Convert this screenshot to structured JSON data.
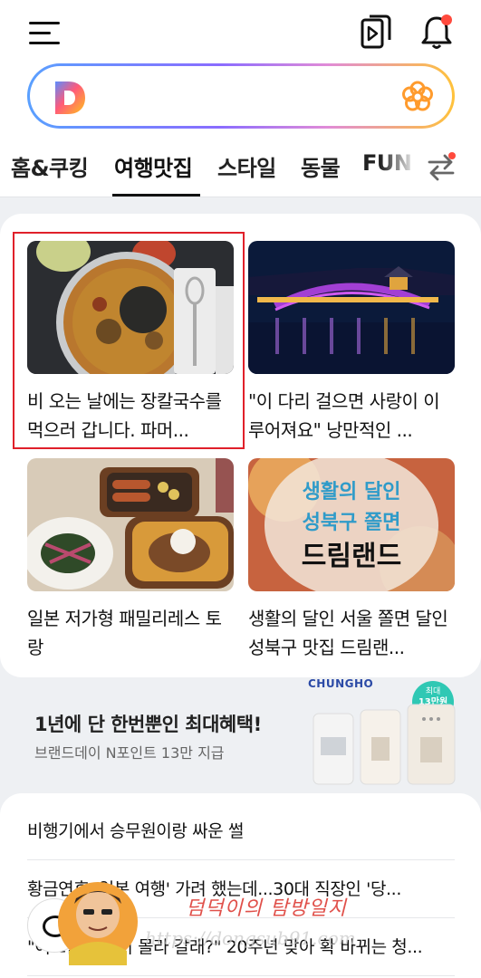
{
  "header": {
    "icons": [
      "hamburger-menu-icon",
      "video-icon",
      "bell-icon"
    ],
    "notification_dot_color": "#ff4a3d"
  },
  "search": {
    "placeholder": "",
    "value": "",
    "logo_letter": "D",
    "flower_color": "#ff9b2d"
  },
  "tabs": [
    {
      "label": "홈&쿠킹",
      "active": false
    },
    {
      "label": "여행맛집",
      "active": true
    },
    {
      "label": "스타일",
      "active": false
    },
    {
      "label": "동물",
      "active": false
    },
    {
      "label": "FUN",
      "active": false
    }
  ],
  "cards": [
    {
      "title": "비 오는 날에는 장칼국수를 먹으러 갑니다. 파머...",
      "highlighted": true
    },
    {
      "title": "\"이 다리 걸으면 사랑이 이루어져요\" 낭만적인 ..."
    },
    {
      "title": "일본 저가형 패밀리레스 토랑"
    },
    {
      "title": "생활의 달인 서울 쫄면 달인 성북구 맛집 드림랜...",
      "overlay_lines": [
        "생활의 달인",
        "성북구 쫄면",
        "드림랜드"
      ]
    }
  ],
  "ad": {
    "headline": "1년에 단 한번뿐인 최대혜택!",
    "sub": "브랜드데이 N포인트 13만 지급",
    "brand": "CHUNGHO",
    "badge_top": "최대",
    "badge_main": "13만원",
    "badge_bottom": "지급"
  },
  "list": [
    "비행기에서 승무원이랑 싸운 썰",
    "황금연휴 '일본 여행' 가려 했는데...30대 직장인 '당...",
    "\"어느날 갑자기 몰라 갈래?\" 20주년 맞아 확 바뀌는 청..."
  ],
  "watermark": {
    "name": "덤덕이의 탐방일지",
    "url": "https://dongsub91.com"
  }
}
